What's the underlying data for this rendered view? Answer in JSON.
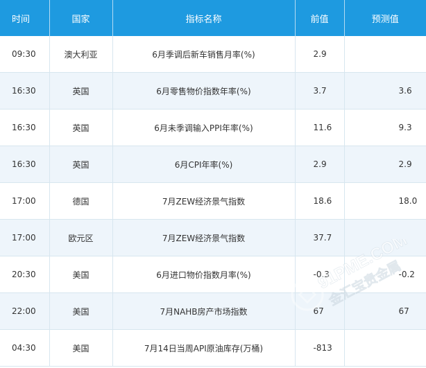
{
  "table": {
    "headers": {
      "time": "时间",
      "country": "国家",
      "indicator": "指标名称",
      "previous": "前值",
      "forecast": "预测值"
    },
    "rows": [
      {
        "time": "09:30",
        "country": "澳大利亚",
        "indicator": "6月季调后新车销售月率(%)",
        "previous": "2.9",
        "forecast": ""
      },
      {
        "time": "16:30",
        "country": "英国",
        "indicator": "6月零售物价指数年率(%)",
        "previous": "3.7",
        "forecast": "3.6"
      },
      {
        "time": "16:30",
        "country": "英国",
        "indicator": "6月未季调输入PPI年率(%)",
        "previous": "11.6",
        "forecast": "9.3"
      },
      {
        "time": "16:30",
        "country": "英国",
        "indicator": "6月CPI年率(%)",
        "previous": "2.9",
        "forecast": "2.9"
      },
      {
        "time": "17:00",
        "country": "德国",
        "indicator": "7月ZEW经济景气指数",
        "previous": "18.6",
        "forecast": "18.0"
      },
      {
        "time": "17:00",
        "country": "欧元区",
        "indicator": "7月ZEW经济景气指数",
        "previous": "37.7",
        "forecast": ""
      },
      {
        "time": "20:30",
        "country": "美国",
        "indicator": "6月进口物价指数月率(%)",
        "previous": "-0.3",
        "forecast": "-0.2"
      },
      {
        "time": "22:00",
        "country": "美国",
        "indicator": "7月NAHB房产市场指数",
        "previous": "67",
        "forecast": "67"
      },
      {
        "time": "04:30",
        "country": "美国",
        "indicator": "7月14日当周API原油库存(万桶)",
        "previous": "-813",
        "forecast": ""
      }
    ]
  },
  "watermark": {
    "line1": "91PME.COM",
    "line2": "金汇宝贵金属"
  },
  "colors": {
    "header_bg": "#1e9ae0",
    "header_text": "#ffffff",
    "alt_row_bg": "#eef5fb",
    "grid": "#d7e6ef"
  }
}
